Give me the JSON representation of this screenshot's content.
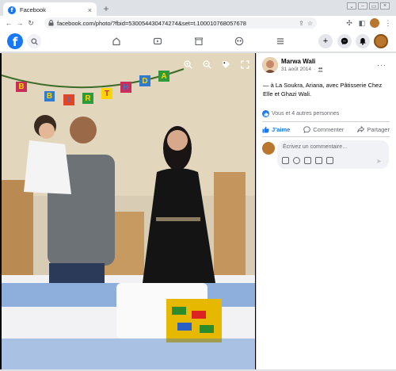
{
  "browser": {
    "tab_title": "Facebook",
    "tab_close": "×",
    "new_tab": "+",
    "url": "facebook.com/photo/?fbid=530054430474274&set=t.100010768057678"
  },
  "facebook": {
    "logo_letter": "f",
    "photo_scene": {
      "banner_letters": [
        "B",
        "I",
        "R",
        "T",
        "H",
        "D",
        "A"
      ]
    },
    "post": {
      "author": "Marwa Wali",
      "date": "31 août 2014",
      "meta_separator": "·",
      "more": "···",
      "caption": "— à La Soukra, Ariana, avec Pâtisserie Chez Elle et Ghazi Wali.",
      "reactions_text": "Vous et 4 autres personnes",
      "actions": {
        "like": "J’aime",
        "comment": "Commenter",
        "share": "Partager"
      },
      "comment_placeholder": "Écrivez un commentaire…",
      "send_icon": "➤"
    }
  },
  "colors": {
    "fb_blue": "#1877f2",
    "secondary_text": "#65676b"
  }
}
